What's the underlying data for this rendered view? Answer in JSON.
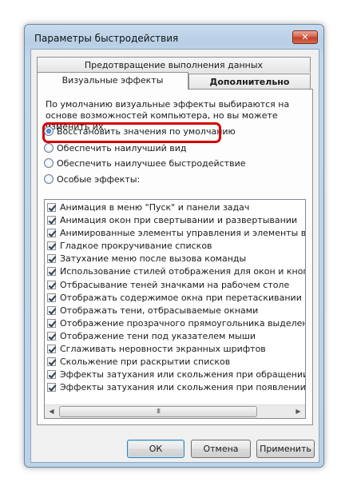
{
  "window": {
    "title": "Параметры быстродействия",
    "close_label": "✕"
  },
  "tabs": [
    {
      "label": "Предотвращение выполнения данных"
    },
    {
      "label": "Визуальные эффекты"
    },
    {
      "label": "Дополнительно"
    }
  ],
  "panel": {
    "description": "По умолчанию визуальные эффекты выбираются на основе возможностей компьютера, но вы можете изменить их.",
    "radio_options": [
      {
        "label": "Восстановить значения по умолчанию",
        "checked": true
      },
      {
        "label": "Обеспечить наилучший вид",
        "checked": false
      },
      {
        "label": "Обеспечить наилучшее быстродействие",
        "checked": false
      },
      {
        "label": "Особые эффекты:",
        "checked": false
      }
    ],
    "effects": [
      {
        "label": "Анимация в меню \"Пуск\" и панели задач",
        "checked": true
      },
      {
        "label": "Анимация окон при свертывании и развертывании",
        "checked": true
      },
      {
        "label": "Анимированные элементы управления и элементы внутри",
        "checked": true
      },
      {
        "label": "Гладкое прокручивание списков",
        "checked": true
      },
      {
        "label": "Затухание меню после вызова команды",
        "checked": true
      },
      {
        "label": "Использование стилей отображения для окон и кнопок",
        "checked": true
      },
      {
        "label": "Отбрасывание теней значками на рабочем столе",
        "checked": true
      },
      {
        "label": "Отображать содержимое окна при перетаскивании",
        "checked": true
      },
      {
        "label": "Отображать тени, отбрасываемые окнами",
        "checked": true
      },
      {
        "label": "Отображение прозрачного прямоугольника выделения",
        "checked": true
      },
      {
        "label": "Отображение тени под указателем мыши",
        "checked": true
      },
      {
        "label": "Сглаживать неровности экранных шрифтов",
        "checked": true
      },
      {
        "label": "Скольжение при раскрытии списков",
        "checked": true
      },
      {
        "label": "Эффекты затухания или скольжения при обращении к ме",
        "checked": true
      },
      {
        "label": "Эффекты затухания или скольжения при появлении подс",
        "checked": true
      }
    ],
    "scrollbar": {
      "left_arrow": "◀",
      "right_arrow": "▶",
      "grip": "III"
    }
  },
  "buttons": {
    "ok": "ОК",
    "cancel": "Отмена",
    "apply": "Применить"
  },
  "colors": {
    "highlight": "#d40000"
  }
}
